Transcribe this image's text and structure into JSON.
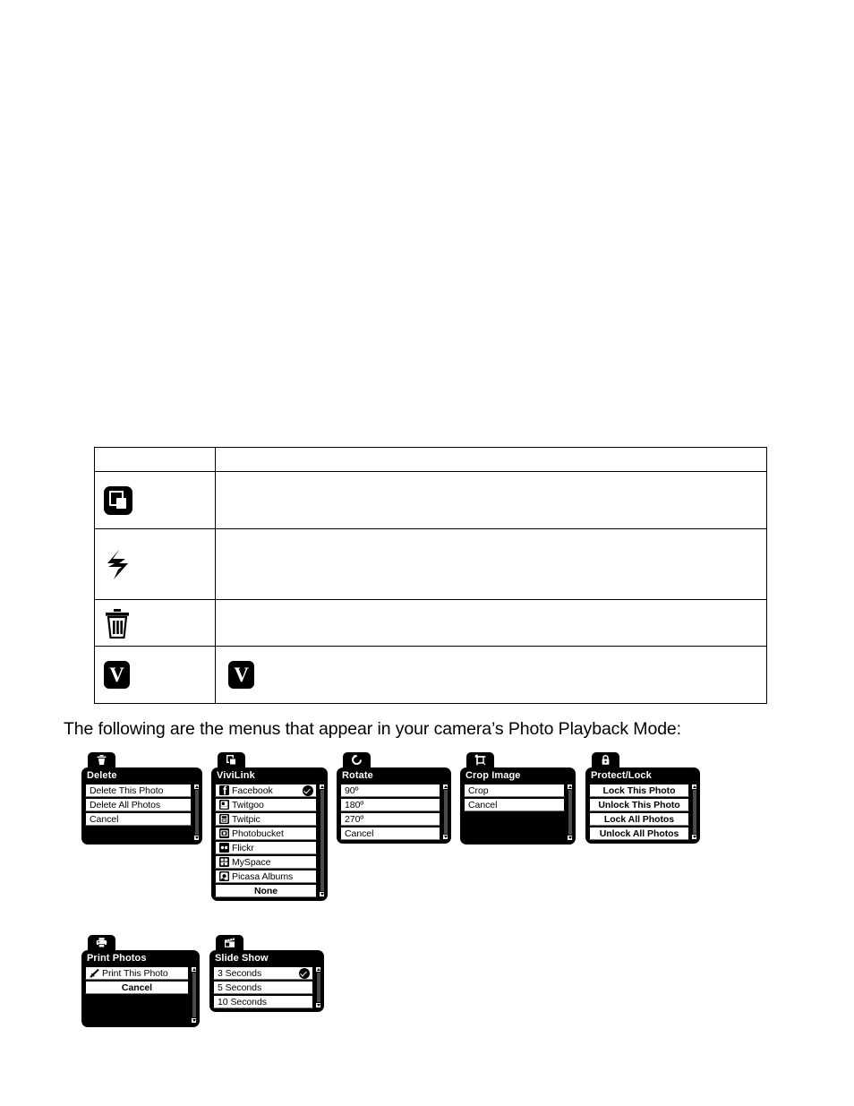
{
  "page": {
    "intro_text": "The following are the menus that appear in your camera’s Photo Playback Mode:"
  },
  "icon_table": {
    "columns": [
      "",
      ""
    ],
    "rows": [
      {
        "icon": "",
        "icon_name": "",
        "desc": ""
      },
      {
        "icon": "layers-icon",
        "icon_name": "multi-shot-layers-icon",
        "desc": ""
      },
      {
        "icon": "flash-icon",
        "icon_name": "flash-lightning-icon",
        "desc": ""
      },
      {
        "icon": "trash-icon",
        "icon_name": "trash-can-icon",
        "desc": ""
      },
      {
        "icon": "vivilink-badge-icon",
        "icon_name": "vivilink-v-badge-icon",
        "desc": "",
        "desc_icon": "vivilink-v-badge-icon"
      }
    ]
  },
  "menus": [
    {
      "id": "delete",
      "title": "Delete",
      "tab_icon": "trash-icon",
      "items": [
        {
          "label": "Delete This Photo"
        },
        {
          "label": "Delete All Photos"
        },
        {
          "label": "Cancel"
        }
      ],
      "filler_rows": 1,
      "scrollbar": true
    },
    {
      "id": "vivilink",
      "title": "ViviLink",
      "tab_icon": "layers-icon",
      "items": [
        {
          "label": "Facebook",
          "icon": "facebook-icon",
          "checked": true
        },
        {
          "label": "Twitgoo",
          "icon": "twitgoo-icon"
        },
        {
          "label": "Twitpic",
          "icon": "twitpic-icon"
        },
        {
          "label": "Photobucket",
          "icon": "photobucket-icon"
        },
        {
          "label": "Flickr",
          "icon": "flickr-icon"
        },
        {
          "label": "MySpace",
          "icon": "myspace-icon"
        },
        {
          "label": "Picasa Albums",
          "icon": "picasa-icon"
        },
        {
          "label": "None",
          "center": true
        }
      ],
      "filler_rows": 0,
      "scrollbar": true
    },
    {
      "id": "rotate",
      "title": "Rotate",
      "tab_icon": "rotate-icon",
      "items": [
        {
          "label": "90º"
        },
        {
          "label": "180º"
        },
        {
          "label": "270º"
        },
        {
          "label": "Cancel"
        }
      ],
      "filler_rows": 0,
      "scrollbar": true
    },
    {
      "id": "crop",
      "title": "Crop Image",
      "tab_icon": "crop-icon",
      "items": [
        {
          "label": "Crop"
        },
        {
          "label": "Cancel"
        }
      ],
      "filler_rows": 2,
      "scrollbar": true
    },
    {
      "id": "protect",
      "title": "Protect/Lock",
      "tab_icon": "lock-icon",
      "items": [
        {
          "label": "Lock This Photo",
          "center": true
        },
        {
          "label": "Unlock This Photo",
          "center": true
        },
        {
          "label": "Lock All Photos",
          "center": true
        },
        {
          "label": "Unlock All Photos",
          "center": true
        }
      ],
      "filler_rows": 0,
      "scrollbar": true
    },
    {
      "id": "print",
      "title": "Print Photos",
      "tab_icon": "printer-icon",
      "items": [
        {
          "label": "Print This Photo",
          "icon": "print-mark-icon"
        },
        {
          "label": "Cancel",
          "center": true
        }
      ],
      "filler_rows": 2,
      "scrollbar": true
    },
    {
      "id": "slideshow",
      "title": "Slide Show",
      "tab_icon": "slideshow-icon",
      "items": [
        {
          "label": "3 Seconds",
          "checked": true
        },
        {
          "label": "5 Seconds"
        },
        {
          "label": "10 Seconds"
        }
      ],
      "filler_rows": 0,
      "scrollbar": true
    }
  ],
  "colors": {
    "menu_background": "#000000",
    "item_background": "#ffffff",
    "text": "#000000",
    "title_text": "#ffffff",
    "scroll_thumb": "#4a4a4a"
  }
}
